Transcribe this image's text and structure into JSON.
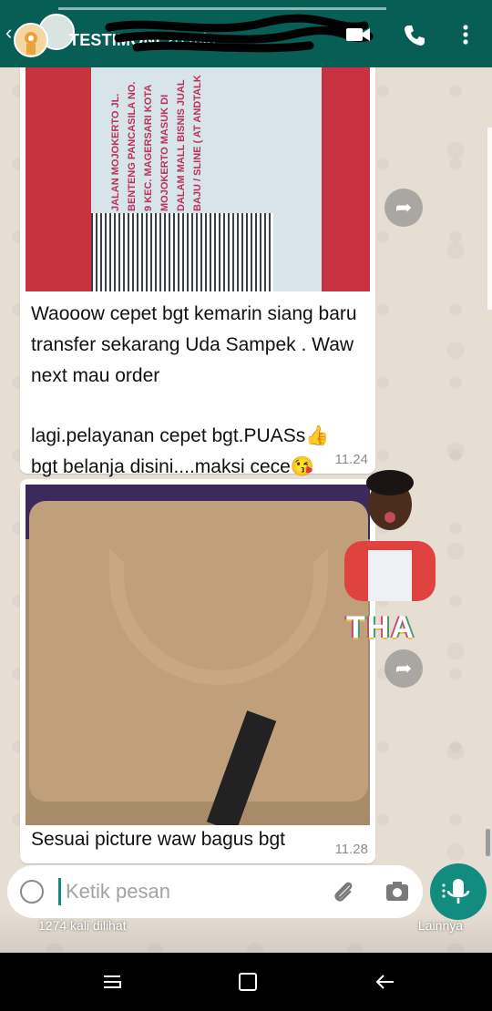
{
  "header": {
    "title": "TESTIMONI",
    "time": "20 min"
  },
  "messages": [
    {
      "text": "Waooow cepet bgt kemarin siang baru transfer sekarang Uda Sampek . Waw next mau order",
      "text2": "lagi.pelayanan cepet bgt.PUASs👍 bgt belanja disini....maksi cece😘",
      "time": "11.24",
      "photo_text": "JALAN MOJOKERTO JL. BENTENG PANCASILA NO. 9 KEC. MAGERSARI KOTA MOJOKERTO MASUK DI DALAM MALL BISNIS JUAL BAJU / SLINE ( AT ANDTALK"
    },
    {
      "caption": "Sesuai picture waw bagus bgt",
      "time": "11.28"
    }
  ],
  "sticker": {
    "text": "THA"
  },
  "input": {
    "placeholder": "Ketik pesan"
  },
  "footer": {
    "views": "1274 kali dilihat",
    "more": "Lainnya"
  },
  "colors": {
    "header": "#075e54",
    "accent": "#128c7e"
  }
}
